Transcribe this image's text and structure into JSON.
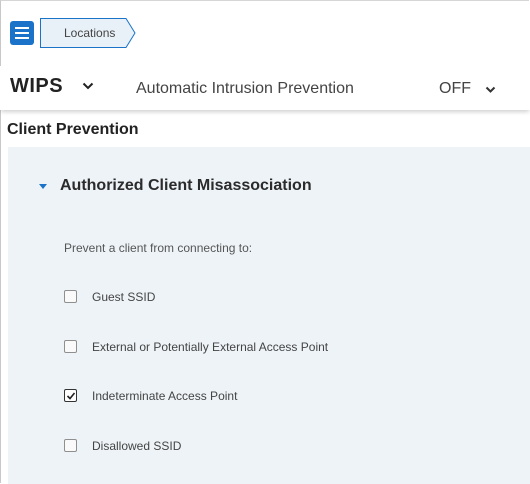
{
  "breadcrumb": {
    "label": "Locations"
  },
  "header": {
    "module": "WIPS",
    "setting_label": "Automatic Intrusion Prevention",
    "setting_value": "OFF"
  },
  "section": {
    "title": "Client Prevention"
  },
  "panel": {
    "title": "Authorized Client Misassociation",
    "prompt": "Prevent a client from connecting to:",
    "options": [
      {
        "label": "Guest SSID",
        "checked": false
      },
      {
        "label": "External or Potentially External Access Point",
        "checked": false
      },
      {
        "label": "Indeterminate Access Point",
        "checked": true
      },
      {
        "label": "Disallowed SSID",
        "checked": false
      }
    ]
  },
  "colors": {
    "accent": "#1a73c8",
    "panel_bg": "#eef3f7"
  },
  "icons": {
    "menu": "hamburger-icon",
    "dropdown": "chevron-down-icon",
    "expand": "caret-down-icon",
    "check": "checkmark-icon"
  }
}
